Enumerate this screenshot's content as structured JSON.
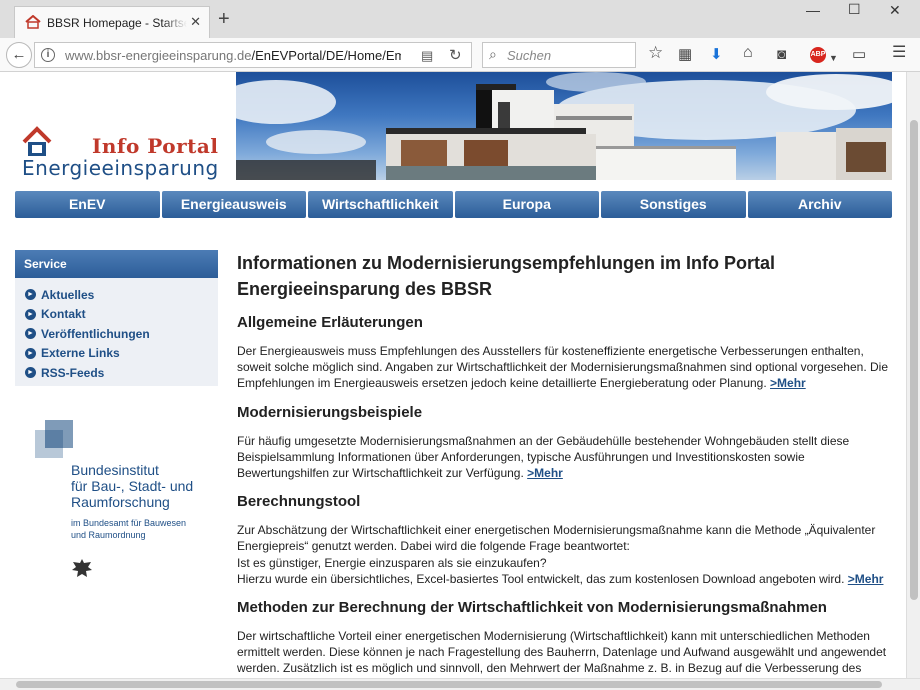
{
  "browser": {
    "tab_title": "BBSR Homepage - Startseite",
    "url_host": "www.bbsr-energieeinsparung.de",
    "url_path": "/EnEVPortal/DE/Home/Emp",
    "search_placeholder": "Suchen"
  },
  "header": {
    "logo_info": "Info Portal",
    "logo_energie": "Energieeinsparung"
  },
  "mainnav": [
    "EnEV",
    "Energieausweis",
    "Wirtschaftlichkeit",
    "Europa",
    "Sonstiges",
    "Archiv"
  ],
  "sidebar": {
    "title": "Service",
    "items": [
      "Aktuelles",
      "Kontakt",
      "Veröffentlichungen",
      "Externe Links",
      "RSS-Feeds"
    ]
  },
  "bbsr": {
    "name_line1": "Bundesinstitut",
    "name_line2": "für Bau-, Stadt- und",
    "name_line3": "Raumforschung",
    "sub_line1": "im Bundesamt für Bauwesen",
    "sub_line2": "und Raumordnung"
  },
  "content": {
    "title": "Informationen zu Modernisierungsempfehlungen im Info Portal Energieeinsparung des BBSR",
    "sections": [
      {
        "heading": "Allgemeine Erläuterungen",
        "text": "Der Energieausweis muss Empfehlungen des Ausstellers für kosteneffiziente energetische Verbesserungen enthalten, soweit solche möglich sind. Angaben zur Wirtschaftlichkeit der Modernisierungsmaßnahmen sind optional vorgesehen. Die Empfehlungen im Energieausweis ersetzen jedoch keine detaillierte Energieberatung oder Planung.",
        "link": ">Mehr"
      },
      {
        "heading": "Modernisierungsbeispiele",
        "text": "Für häufig umgesetzte Modernisierungsmaßnahmen an der Gebäudehülle bestehender Wohngebäuden stellt diese Beispielsammlung Informationen über Anforderungen, typische Ausführungen und Investitionskosten sowie Bewertungshilfen zur Wirtschaftlichkeit zur Verfügung.",
        "link": ">Mehr"
      },
      {
        "heading": "Berechnungstool",
        "text1": "Zur Abschätzung der Wirtschaftlichkeit einer energetischen Modernisierungsmaßnahme kann die Methode „Äquivalenter Energiepreis“ genutzt werden. Dabei wird die folgende Frage beantwortet:",
        "text2": "Ist es günstiger, Energie einzusparen als sie einzukaufen?",
        "text3": "Hierzu wurde ein übersichtliches, Excel-basiertes Tool entwickelt, das zum kostenlosen Download angeboten wird.",
        "link": ">Mehr"
      },
      {
        "heading": "Methoden zur Berechnung der Wirtschaftlichkeit von Modernisierungsmaßnahmen",
        "text": "Der wirtschaftliche Vorteil einer energetischen Modernisierung (Wirtschaftlichkeit) kann mit unterschiedlichen Methoden ermittelt werden. Diese können je nach Fragestellung des Bauherrn, Datenlage und Aufwand ausgewählt und angewendet werden. Zusätzlich ist es möglich und sinnvoll, den Mehrwert der Maßnahme z. B. in Bezug auf die Verbesserung des Wohnkomforts, die"
      }
    ]
  },
  "colors": {
    "brand_blue": "#1f4f86",
    "logo_red": "#c0392b",
    "nav_blue": "#2b5d98"
  }
}
